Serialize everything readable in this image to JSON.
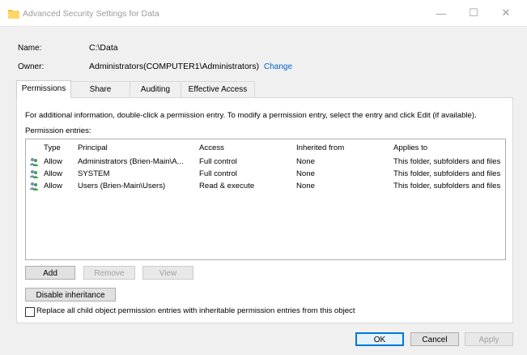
{
  "window": {
    "title": "Advanced Security Settings for Data",
    "minimize_glyph": "—",
    "maximize_glyph": "☐",
    "close_glyph": "✕"
  },
  "fields": {
    "name_label": "Name:",
    "name_value": "C:\\Data",
    "owner_label": "Owner:",
    "owner_value": "Administrators(COMPUTER1\\Administrators)",
    "change_link": "Change"
  },
  "tabs": [
    {
      "label": "Permissions",
      "active": true
    },
    {
      "label": "Share",
      "active": false
    },
    {
      "label": "Auditing",
      "active": false
    },
    {
      "label": "Effective Access",
      "active": false
    }
  ],
  "permissions": {
    "info_text": "For additional information, double-click a permission entry. To modify a permission entry, select the entry and click Edit (if available).",
    "entries_label": "Permission entries:",
    "columns": [
      "Type",
      "Principal",
      "Access",
      "Inherited from",
      "Applies to"
    ],
    "rows": [
      {
        "type": "Allow",
        "principal": "Administrators (Brien-Main\\A...",
        "access": "Full control",
        "inherited": "None",
        "applies": "This folder, subfolders and files"
      },
      {
        "type": "Allow",
        "principal": "SYSTEM",
        "access": "Full control",
        "inherited": "None",
        "applies": "This folder, subfolders and files"
      },
      {
        "type": "Allow",
        "principal": "Users (Brien-Main\\Users)",
        "access": "Read & execute",
        "inherited": "None",
        "applies": "This folder, subfolders and files"
      }
    ],
    "add_label": "Add",
    "remove_label": "Remove",
    "view_label": "View",
    "disable_inheritance_label": "Disable inheritance",
    "replace_label": "Replace all child object permission entries with inheritable permission entries from this object"
  },
  "footer": {
    "ok_label": "OK",
    "cancel_label": "Cancel",
    "apply_label": "Apply"
  },
  "icons": {
    "folder": "folder-icon",
    "user": "users-icon"
  },
  "colors": {
    "link": "#0066cc",
    "primary_border": "#0078d7",
    "folder": "#f5c542"
  }
}
